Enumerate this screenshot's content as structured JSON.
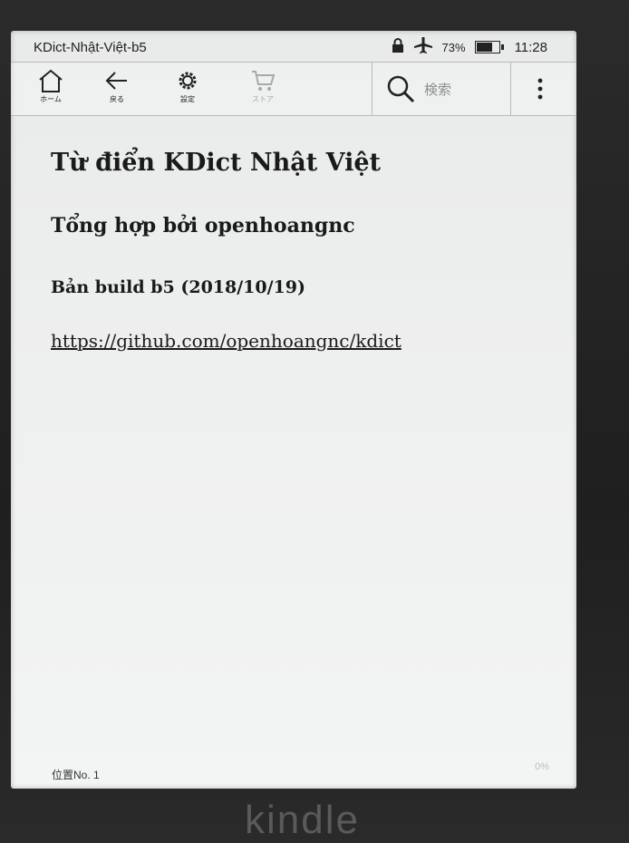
{
  "status": {
    "title": "KDict-Nhật-Việt-b5",
    "battery_percent": "73%",
    "battery_level": 0.73,
    "time": "11:28",
    "icons": [
      "lock-icon",
      "airplane-icon",
      "battery-icon"
    ]
  },
  "toolbar": {
    "home_label": "ホーム",
    "back_label": "戻る",
    "settings_label": "設定",
    "store_label": "ストア",
    "search_placeholder": "検索"
  },
  "content": {
    "title": "Từ điển KDict Nhật Việt",
    "subtitle": "Tổng hợp bởi openhoangnc",
    "build": "Bản build b5 (2018/10/19)",
    "url": "https://github.com/openhoangnc/kdict"
  },
  "footer": {
    "location": "位置No. 1",
    "progress": "0%"
  },
  "device": {
    "brand": "kindle"
  }
}
